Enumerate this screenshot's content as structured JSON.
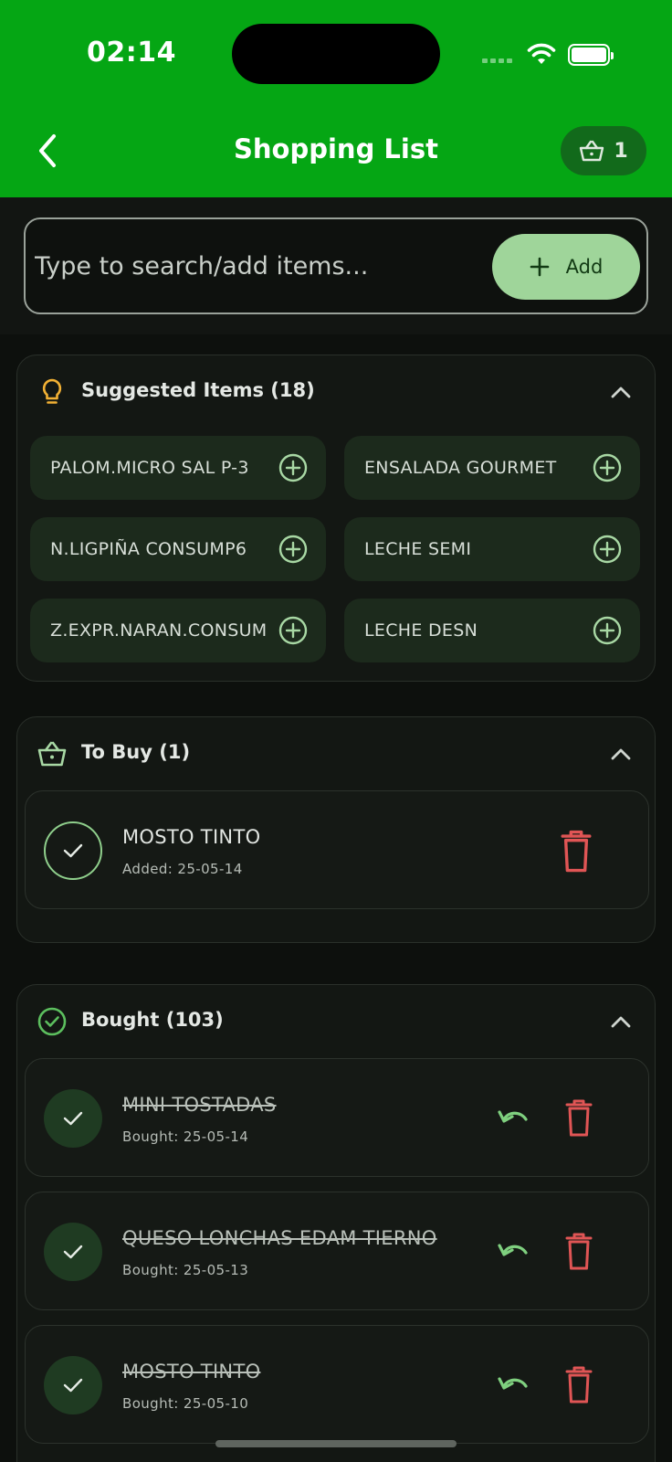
{
  "status_bar": {
    "time": "02:14"
  },
  "header": {
    "title": "Shopping List",
    "cart_count": "1"
  },
  "search": {
    "placeholder": "Type to search/add items...",
    "add_label": "Add"
  },
  "suggested": {
    "title": "Suggested Items (18)",
    "items": [
      "PALOM.MICRO SAL P-3",
      "ENSALADA GOURMET",
      "N.LIGPIÑA CONSUMP6",
      "LECHE SEMI",
      "Z.EXPR.NARAN.CONSUM",
      "LECHE DESN"
    ]
  },
  "to_buy": {
    "title": "To Buy (1)",
    "items": [
      {
        "name": "MOSTO TINTO",
        "date": "Added: 25-05-14"
      }
    ]
  },
  "bought": {
    "title": "Bought (103)",
    "items": [
      {
        "name": "MINI TOSTADAS",
        "date": "Bought: 25-05-14"
      },
      {
        "name": "QUESO LONCHAS EDAM TIERNO",
        "date": "Bought: 25-05-13"
      },
      {
        "name": "MOSTO TINTO",
        "date": "Bought: 25-05-10"
      }
    ]
  },
  "colors": {
    "header_green": "#05a614",
    "accent_light_green": "#9fd59a",
    "delete_red": "#e05555",
    "suggest_bulb": "#f2b134"
  },
  "icons": {
    "back": "chevron-left-icon",
    "cart": "basket-icon",
    "add": "plus-icon",
    "suggested": "lightbulb-icon",
    "to_buy": "basket-icon",
    "bought": "check-circle-icon",
    "collapse": "chevron-up-icon",
    "undo": "undo-icon",
    "delete": "trash-icon"
  }
}
